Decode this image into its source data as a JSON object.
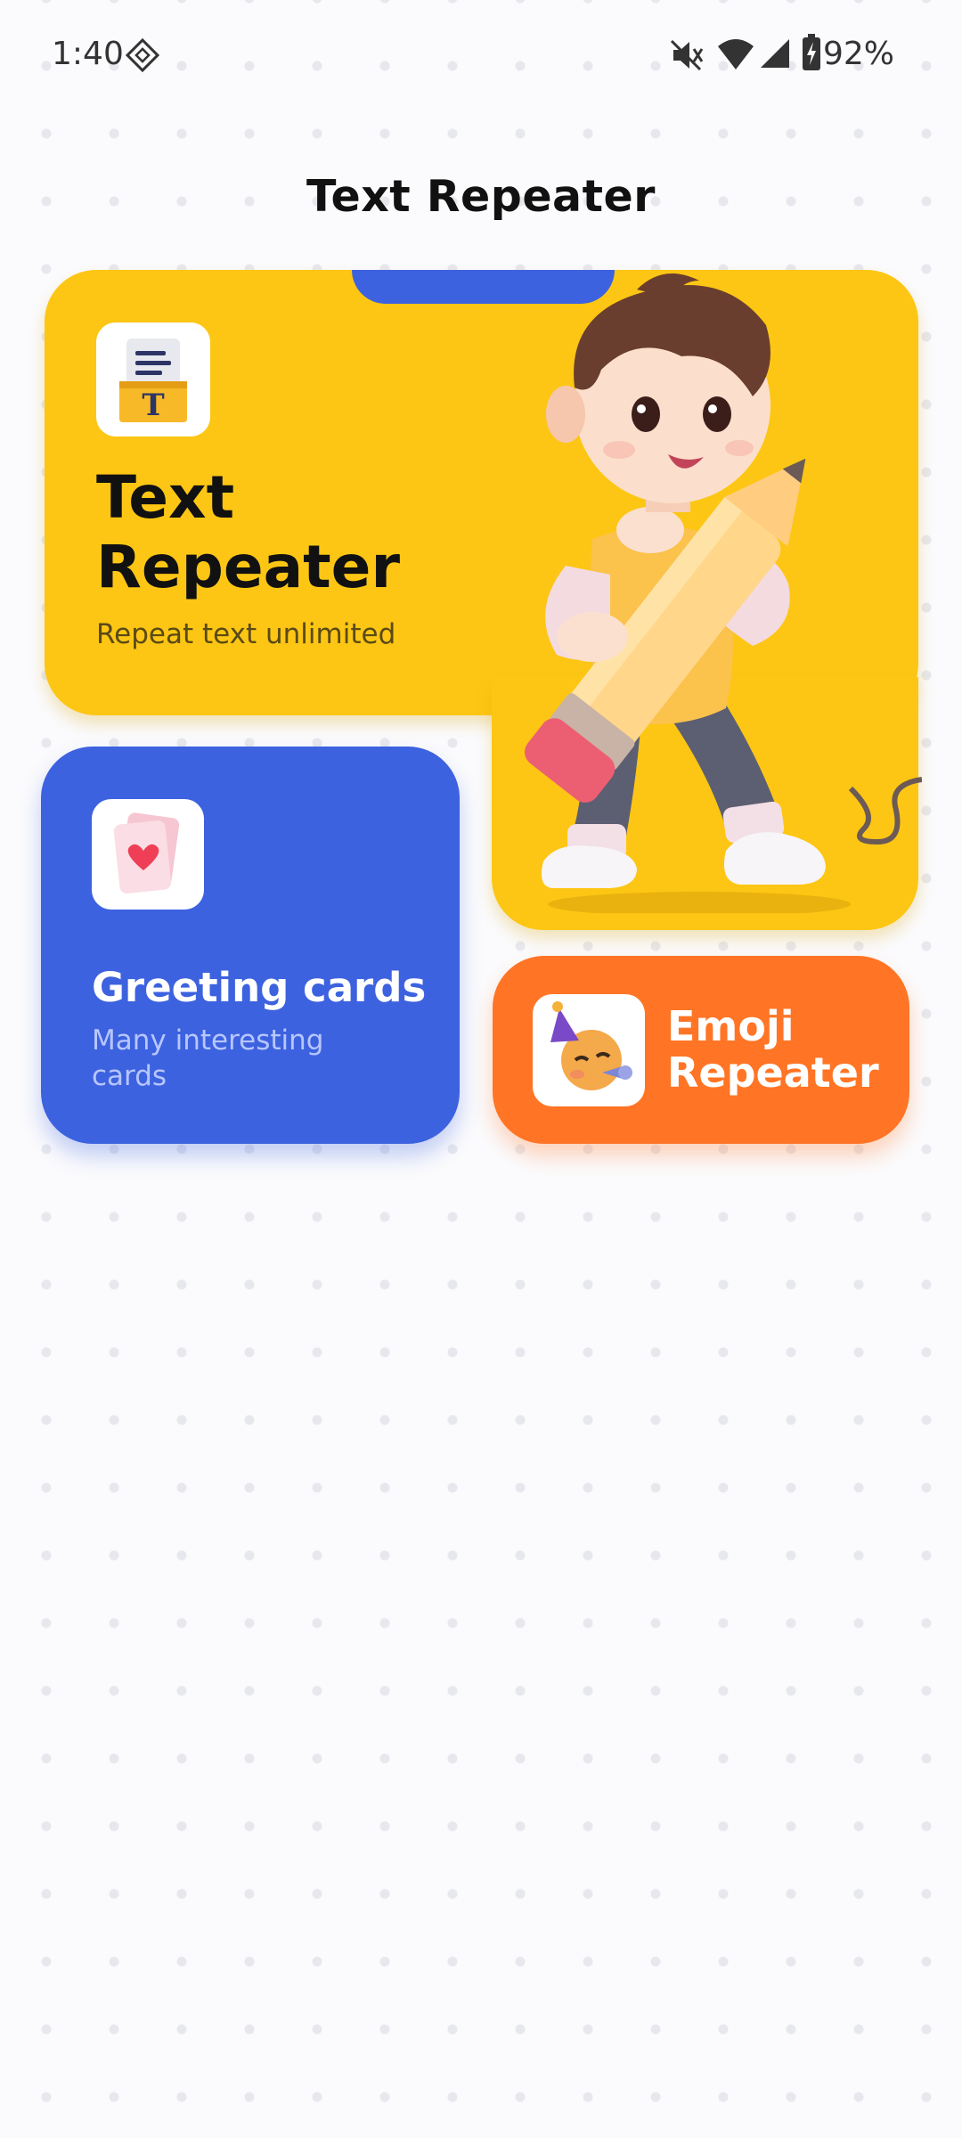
{
  "status_bar": {
    "time": "1:40",
    "battery": "92%",
    "icons": [
      "nfc-icon",
      "mute-icon",
      "wifi-icon",
      "cellular-signal-icon",
      "battery-charging-icon"
    ]
  },
  "page": {
    "title": "Text Repeater"
  },
  "cards": {
    "text_repeater": {
      "title": "Text\nRepeater",
      "subtitle": "Repeat text unlimited",
      "icon": "document-text-icon",
      "color": "#fdc614"
    },
    "greeting_cards": {
      "title": "Greeting cards",
      "subtitle": "Many interesting cards",
      "icon": "heart-card-icon",
      "color": "#3d62df"
    },
    "emoji_repeater": {
      "title": "Emoji\nRepeater",
      "icon": "party-emoji-icon",
      "color": "#ff7525"
    }
  },
  "illustration": "boy-holding-pencil-illustration"
}
